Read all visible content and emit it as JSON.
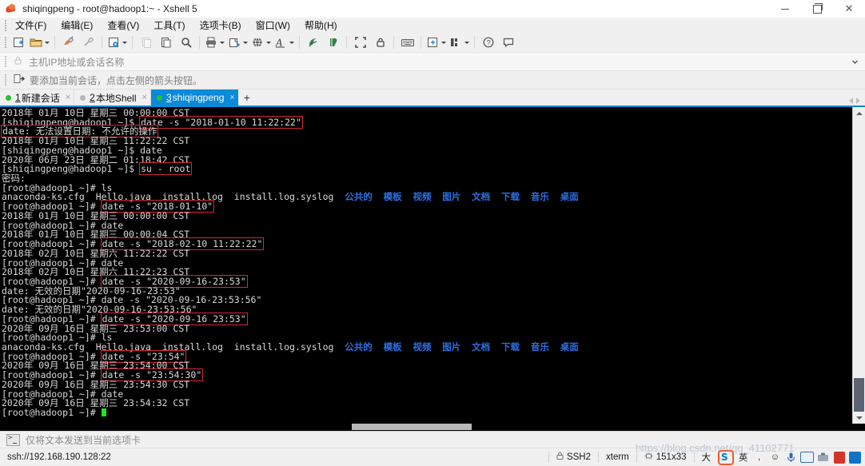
{
  "window": {
    "title": "shiqingpeng - root@hadoop1:~ - Xshell 5",
    "app_icon": "xshell-icon",
    "minimize_label": "–",
    "maximize_label": "❐",
    "close_label": "✕"
  },
  "menu": {
    "items": [
      {
        "label": "文件(F)",
        "name": "menu-file"
      },
      {
        "label": "编辑(E)",
        "name": "menu-edit"
      },
      {
        "label": "查看(V)",
        "name": "menu-view"
      },
      {
        "label": "工具(T)",
        "name": "menu-tools"
      },
      {
        "label": "选项卡(B)",
        "name": "menu-tabs"
      },
      {
        "label": "窗口(W)",
        "name": "menu-window"
      },
      {
        "label": "帮助(H)",
        "name": "menu-help"
      }
    ]
  },
  "toolbar": {
    "buttons": [
      "new-session-icon",
      "open-folder-icon",
      "connect-icon",
      "disconnect-icon",
      "session-properties-icon",
      "copy-paste-icon",
      "paste-icon",
      "find-icon",
      "print-icon",
      "transfer-icon",
      "globe-icon",
      "font-icon",
      "xftp-icon",
      "xagent-icon",
      "fullscreen-icon",
      "lock-icon",
      "keyboard-icon",
      "add-layout-icon",
      "arrange-icon",
      "help-icon",
      "comment-icon"
    ]
  },
  "address_bar": {
    "placeholder": "主机IP地址或会话名称",
    "lock_icon": "lock-icon",
    "dropdown_icon": "chevron-down-icon"
  },
  "hint_bar": {
    "icon": "add-session-icon",
    "text": "要添加当前会话，点击左侧的箭头按钮。"
  },
  "tabs": {
    "items": [
      {
        "num": "1",
        "label": "新建会话",
        "status": "on",
        "active": false,
        "close": "×"
      },
      {
        "num": "2",
        "label": "本地Shell",
        "status": "off",
        "active": false,
        "close": "×"
      },
      {
        "num": "3",
        "label": "shiqingpeng",
        "status": "on",
        "active": true,
        "close": "×"
      }
    ],
    "add_label": "+",
    "active_color": "#0a8ad8"
  },
  "terminal": {
    "background": "#000000",
    "foreground": "#d6d6d6",
    "dir_color": "#2b6fe0",
    "highlight_color": "#d6263a",
    "cursor_color": "#1de81d",
    "prompt_user": "[shiqingpeng@hadoop1 ~]$ ",
    "prompt_root": "[root@hadoop1 ~]# ",
    "lines": [
      {
        "id": 1,
        "segs": [
          {
            "t": "2018年 01月 10日 星期三 00:00:00 CST"
          }
        ]
      },
      {
        "id": 2,
        "segs": [
          {
            "t": "[shiqingpeng@hadoop1 ~]$ "
          },
          {
            "t": "date -s \"2018-01-10 11:22:22\"",
            "box": true
          }
        ]
      },
      {
        "id": 3,
        "segs": [
          {
            "t": "date: 无法设置日期: 不允许的操作",
            "box": true
          }
        ]
      },
      {
        "id": 4,
        "segs": [
          {
            "t": "2018年 01月 10日 星期三 11:22:22 CST"
          }
        ]
      },
      {
        "id": 5,
        "segs": [
          {
            "t": "[shiqingpeng@hadoop1 ~]$ date"
          }
        ]
      },
      {
        "id": 6,
        "segs": [
          {
            "t": "2020年 06月 23日 星期二 01:18:42 CST"
          }
        ]
      },
      {
        "id": 7,
        "segs": [
          {
            "t": "[shiqingpeng@hadoop1 ~]$ "
          },
          {
            "t": "su - root",
            "box": true
          }
        ]
      },
      {
        "id": 8,
        "segs": [
          {
            "t": "密码:"
          }
        ]
      },
      {
        "id": 9,
        "segs": [
          {
            "t": "[root@hadoop1 ~]# ls"
          }
        ]
      },
      {
        "id": 10,
        "segs": [
          {
            "t": "anaconda-ks.cfg  Hello.java  install.log  install.log.syslog  "
          },
          {
            "t": "公共的  模板  视频  图片  文档  下载  音乐  桌面",
            "c": "blue"
          }
        ]
      },
      {
        "id": 11,
        "segs": [
          {
            "t": "[root@hadoop1 ~]# "
          },
          {
            "t": "date -s \"2018-01-10\"",
            "box": true
          }
        ]
      },
      {
        "id": 12,
        "segs": [
          {
            "t": "2018年 01月 10日 星期三 00:00:00 CST"
          }
        ]
      },
      {
        "id": 13,
        "segs": [
          {
            "t": "[root@hadoop1 ~]# date"
          }
        ]
      },
      {
        "id": 14,
        "segs": [
          {
            "t": "2018年 01月 10日 星期三 00:00:04 CST"
          }
        ]
      },
      {
        "id": 15,
        "segs": [
          {
            "t": "[root@hadoop1 ~]# "
          },
          {
            "t": "date -s \"2018-02-10 11:22:22\"",
            "box": true
          }
        ]
      },
      {
        "id": 16,
        "segs": [
          {
            "t": "2018年 02月 10日 星期六 11:22:22 CST"
          }
        ]
      },
      {
        "id": 17,
        "segs": [
          {
            "t": "[root@hadoop1 ~]# date"
          }
        ]
      },
      {
        "id": 18,
        "segs": [
          {
            "t": "2018年 02月 10日 星期六 11:22:23 CST"
          }
        ]
      },
      {
        "id": 19,
        "segs": [
          {
            "t": "[root@hadoop1 ~]# "
          },
          {
            "t": "date -s \"2020-09-16-23:53\"",
            "box": true
          }
        ]
      },
      {
        "id": 20,
        "segs": [
          {
            "t": "date: 无效的日期\"2020-09-16-23:53\""
          }
        ]
      },
      {
        "id": 21,
        "segs": [
          {
            "t": "[root@hadoop1 ~]# date -s \"2020-09-16-23:53:56\""
          }
        ]
      },
      {
        "id": 22,
        "segs": [
          {
            "t": "date: 无效的日期\"2020-09-16-23:53:56\""
          }
        ]
      },
      {
        "id": 23,
        "segs": [
          {
            "t": "[root@hadoop1 ~]# "
          },
          {
            "t": "date -s \"2020-09-16 23:53\"",
            "box": true
          }
        ]
      },
      {
        "id": 24,
        "segs": [
          {
            "t": "2020年 09月 16日 星期三 23:53:00 CST"
          }
        ]
      },
      {
        "id": 25,
        "segs": [
          {
            "t": "[root@hadoop1 ~]# ls"
          }
        ]
      },
      {
        "id": 26,
        "segs": [
          {
            "t": "anaconda-ks.cfg  Hello.java  install.log  install.log.syslog  "
          },
          {
            "t": "公共的  模板  视频  图片  文档  下载  音乐  桌面",
            "c": "blue"
          }
        ]
      },
      {
        "id": 27,
        "segs": [
          {
            "t": "[root@hadoop1 ~]# "
          },
          {
            "t": "date -s \"23:54\"",
            "box": true
          }
        ]
      },
      {
        "id": 28,
        "segs": [
          {
            "t": "2020年 09月 16日 星期三 23:54:00 CST"
          }
        ]
      },
      {
        "id": 29,
        "segs": [
          {
            "t": "[root@hadoop1 ~]# "
          },
          {
            "t": "date -s \"23:54:30\"",
            "box": true
          }
        ]
      },
      {
        "id": 30,
        "segs": [
          {
            "t": "2020年 09月 16日 星期三 23:54:30 CST"
          }
        ]
      },
      {
        "id": 31,
        "segs": [
          {
            "t": "[root@hadoop1 ~]# date"
          }
        ]
      },
      {
        "id": 32,
        "segs": [
          {
            "t": "2020年 09月 16日 星期三 23:54:32 CST"
          }
        ]
      },
      {
        "id": 33,
        "segs": [
          {
            "t": "[root@hadoop1 ~]# "
          },
          {
            "cursor": true
          }
        ]
      }
    ]
  },
  "send_bar": {
    "icon": "terminal-send-icon",
    "text": "仅将文本发送到当前选项卡"
  },
  "status_bar": {
    "url": "ssh://192.168.190.128:22",
    "protocol": "SSH2",
    "protocol_icon": "lock-icon",
    "emulation": "xterm",
    "size_icon": "screen-size-icon",
    "size": "151x33",
    "extra": "大"
  },
  "tray": {
    "items": [
      {
        "name": "sogou-ime-icon",
        "label": "S"
      },
      {
        "name": "ime-lang-icon",
        "label": "英"
      },
      {
        "name": "ime-punct-icon",
        "label": ","
      },
      {
        "name": "ime-emoji-icon",
        "label": "☺"
      },
      {
        "name": "ime-voice-icon",
        "label": "⚲"
      },
      {
        "name": "ime-keyboard-icon",
        "label": ""
      },
      {
        "name": "ime-toolbox-icon",
        "label": ""
      },
      {
        "name": "ime-skin-icon",
        "label": ""
      },
      {
        "name": "ime-more-icon",
        "label": ""
      }
    ]
  },
  "watermark": {
    "text": "https://blog.csdn.net/qq_41102771"
  }
}
